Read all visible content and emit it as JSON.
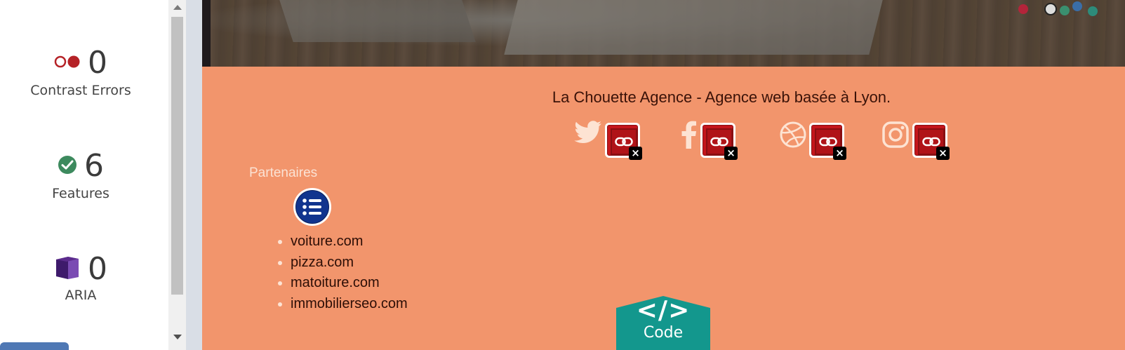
{
  "wave_panel": {
    "stats": [
      {
        "icon": "contrast-errors-icon",
        "value": "0",
        "label": "Contrast Errors"
      },
      {
        "icon": "features-check-icon",
        "value": "6",
        "label": "Features"
      },
      {
        "icon": "aria-cube-icon",
        "value": "0",
        "label": "ARIA"
      }
    ]
  },
  "footer": {
    "tagline": "La Chouette Agence - Agence web basée à Lyon.",
    "social_links": [
      "twitter-icon",
      "facebook-icon",
      "dribbble-icon",
      "instagram-icon"
    ],
    "partners_title": "Partenaires",
    "partners": [
      "voiture.com",
      "pizza.com",
      "matoiture.com",
      "immobilierseo.com"
    ]
  },
  "code_button": {
    "symbol": "</>",
    "label": "Code"
  },
  "colors": {
    "page_bg": "#f2956c",
    "error_red": "#c4161c",
    "feature_green": "#3d8a5e",
    "aria_purple": "#5b2b8c",
    "code_teal": "#13978d"
  }
}
